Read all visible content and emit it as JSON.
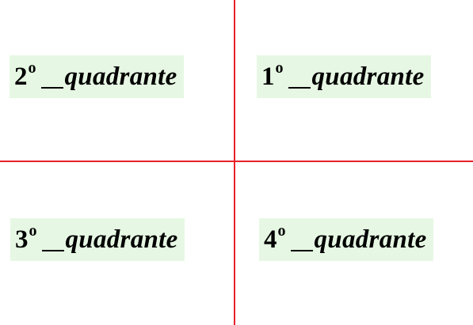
{
  "colors": {
    "axis": "#e8202a",
    "label_background": "#e6f8e3",
    "text": "#000000"
  },
  "quadrants": {
    "q1": {
      "number": "1",
      "ordinal": "o",
      "separator": "_",
      "word": "quadrante"
    },
    "q2": {
      "number": "2",
      "ordinal": "o",
      "separator": "_",
      "word": "quadrante"
    },
    "q3": {
      "number": "3",
      "ordinal": "o",
      "separator": "_",
      "word": "quadrante"
    },
    "q4": {
      "number": "4",
      "ordinal": "o",
      "separator": "_",
      "word": "quadrante"
    }
  }
}
